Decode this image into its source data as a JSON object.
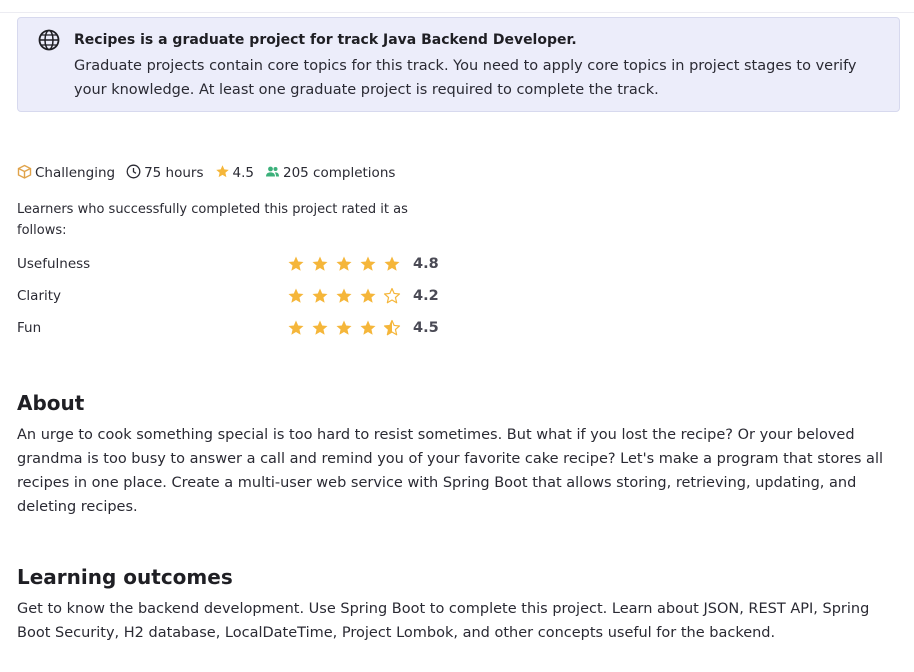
{
  "banner": {
    "icon": "globe-icon",
    "title": "Recipes is a graduate project for track Java Backend Developer.",
    "text": "Graduate projects contain core topics for this track. You need to apply core topics in project stages to verify your knowledge. At least one graduate project is required to complete the track."
  },
  "meta": {
    "difficulty": "Challenging",
    "duration": "75 hours",
    "rating": "4.5",
    "completions": "205 completions",
    "colors": {
      "difficulty_icon": "#e0a34a",
      "star": "#f5b63a",
      "completions_icon": "#3bb07a"
    }
  },
  "ratings": {
    "intro": "Learners who successfully completed this project rated it as follows:",
    "items": [
      {
        "label": "Usefulness",
        "value": "4.8",
        "stars": 4.8
      },
      {
        "label": "Clarity",
        "value": "4.2",
        "stars": 4.2
      },
      {
        "label": "Fun",
        "value": "4.5",
        "stars": 4.5
      }
    ]
  },
  "about": {
    "title": "About",
    "text": "An urge to cook something special is too hard to resist sometimes. But what if you lost the recipe? Or your beloved grandma is too busy to answer a call and remind you of your favorite cake recipe? Let's make a program that stores all recipes in one place. Create a multi-user web service with Spring Boot that allows storing, retrieving, updating, and deleting recipes."
  },
  "outcomes": {
    "title": "Learning outcomes",
    "text": "Get to know the backend development. Use Spring Boot to complete this project. Learn about JSON, REST API, Spring Boot Security, H2 database, LocalDateTime, Project Lombok, and other concepts useful for the backend."
  }
}
